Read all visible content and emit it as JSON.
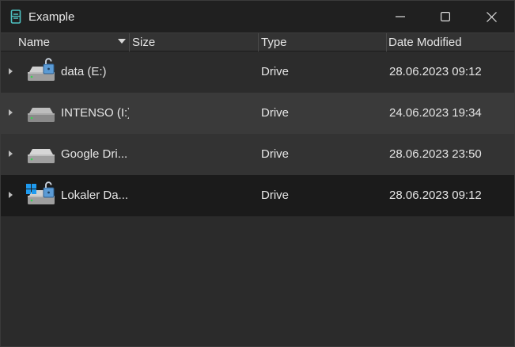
{
  "window": {
    "title": "Example",
    "controls": [
      "minimize-icon",
      "maximize-icon",
      "close-icon"
    ]
  },
  "columns": {
    "name": "Name",
    "size": "Size",
    "type": "Type",
    "date_modified": "Date Modified",
    "sort_column": "name",
    "sort_direction": "descending"
  },
  "rows": [
    {
      "name": "data (E:)",
      "size": "",
      "type": "Drive",
      "date_modified": "28.06.2023 09:12",
      "icon": "drive-unlocked-icon"
    },
    {
      "name": "INTENSO (I:)",
      "size": "",
      "type": "Drive",
      "date_modified": "24.06.2023 19:34",
      "icon": "drive-icon"
    },
    {
      "name": "Google Dri...",
      "size": "",
      "type": "Drive",
      "date_modified": "28.06.2023 23:50",
      "icon": "drive-icon"
    },
    {
      "name": "Lokaler Da...",
      "size": "",
      "type": "Drive",
      "date_modified": "28.06.2023 09:12",
      "icon": "windows-drive-unlocked-icon"
    }
  ],
  "colors": {
    "titlebar": "#202020",
    "background": "#2b2b2b",
    "header": "#333333",
    "row_hover": "#3a3a3a",
    "row_selected": "#1b1b1b",
    "app_icon_accent": "#4fc3c3"
  }
}
